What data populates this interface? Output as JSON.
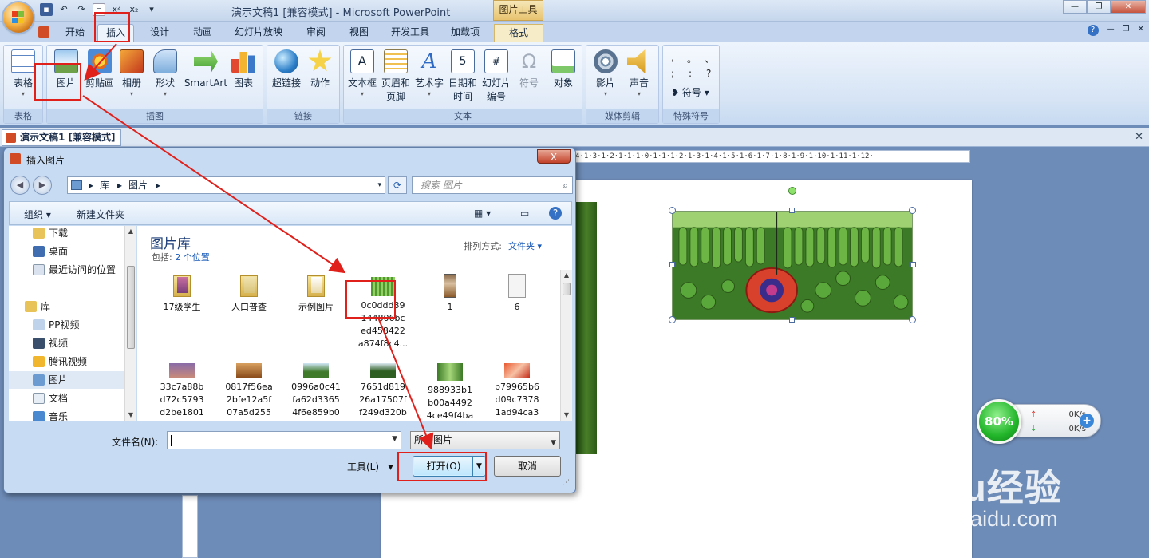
{
  "window": {
    "title": "演示文稿1 [兼容模式] - Microsoft PowerPoint",
    "context_tab_header": "图片工具",
    "controls": [
      "—",
      "❐",
      "✕"
    ]
  },
  "ribbon_tabs": [
    "开始",
    "插入",
    "设计",
    "动画",
    "幻灯片放映",
    "审阅",
    "视图",
    "开发工具",
    "加载项",
    "格式"
  ],
  "ribbon": {
    "table_group": {
      "label": "表格",
      "buttons": [
        "表格"
      ]
    },
    "illustrations_group": {
      "label": "插图",
      "buttons": [
        "图片",
        "剪贴画",
        "相册",
        "形状",
        "SmartArt",
        "图表"
      ]
    },
    "links_group": {
      "label": "链接",
      "buttons": [
        "超链接",
        "动作"
      ]
    },
    "text_group": {
      "label": "文本",
      "buttons": [
        "文本框",
        "页眉和\n页脚",
        "艺术字",
        "日期和\n时间",
        "幻灯片\n编号",
        "符号",
        "对象"
      ]
    },
    "media_group": {
      "label": "媒体剪辑",
      "buttons": [
        "影片",
        "声音"
      ]
    },
    "special_group": {
      "label": "特殊符号",
      "symbols": [
        ",",
        "。",
        "、",
        ";",
        ":",
        "?"
      ],
      "button": "符号"
    }
  },
  "document_tab": "演示文稿1 [兼容模式]",
  "ruler_text": "4·1·3·1·2·1·1·1·0·1·1·1·2·1·3·1·4·1·5·1·6·1·7·1·8·1·9·1·10·1·11·1·12·",
  "dialog": {
    "title": "插入图片",
    "close": "X",
    "address": [
      "库",
      "图片"
    ],
    "search_placeholder": "搜索 图片",
    "organize": "组织",
    "new_folder": "新建文件夹",
    "nav_items": [
      {
        "label": "下载",
        "icon": "download-folder-icon"
      },
      {
        "label": "桌面",
        "icon": "desktop-icon"
      },
      {
        "label": "最近访问的位置",
        "icon": "recent-places-icon"
      },
      {
        "label": "库",
        "icon": "library-icon"
      },
      {
        "label": "PP视频",
        "icon": "pp-video-icon"
      },
      {
        "label": "视频",
        "icon": "video-library-icon"
      },
      {
        "label": "腾讯视频",
        "icon": "tencent-video-icon"
      },
      {
        "label": "图片",
        "icon": "pictures-library-icon"
      },
      {
        "label": "文档",
        "icon": "documents-library-icon"
      },
      {
        "label": "音乐",
        "icon": "music-library-icon"
      }
    ],
    "library_title": "图片库",
    "library_includes_prefix": "包括:",
    "library_includes_link": "2 个位置",
    "arrange_label": "排列方式:",
    "arrange_value": "文件夹 ▾",
    "files_row1": [
      {
        "name": "17级学生",
        "kind": "folder"
      },
      {
        "name": "人口普查",
        "kind": "folder"
      },
      {
        "name": "示例图片",
        "kind": "folder"
      },
      {
        "name": "0c0ddd39\n144806bc\ned458422\na874f8c4...",
        "kind": "image"
      },
      {
        "name": "1",
        "kind": "image"
      },
      {
        "name": "6",
        "kind": "image"
      }
    ],
    "files_row2": [
      {
        "name": "33c7a88b\nd72c5793\nd2be1801"
      },
      {
        "name": "0817f56ea\n2bfe12a5f\n07a5d255"
      },
      {
        "name": "0996a0c41\nfa62d3365\n4f6e859b0"
      },
      {
        "name": "7651d819\n26a17507f\nf249d320b"
      },
      {
        "name": "988933b1\nb00a4492\n4ce49f4ba"
      },
      {
        "name": "b79965b6\nd09c7378\n1ad94ca3"
      }
    ],
    "filename_label": "文件名(N):",
    "filename_value": "",
    "filter_value": "所有图片",
    "tools_label": "工具(L)",
    "open_button": "打开(O)",
    "cancel_button": "取消"
  },
  "net_widget": {
    "percent": "80%",
    "upload": "0K/s",
    "download": "0K/s"
  },
  "watermark": {
    "brand": "Baidu经验",
    "url": "jingyan.baidu.com"
  },
  "colors": {
    "annotation": "#e0201b",
    "ribbon_bg": "#dbe7f6",
    "accent": "#1a5bb8"
  }
}
